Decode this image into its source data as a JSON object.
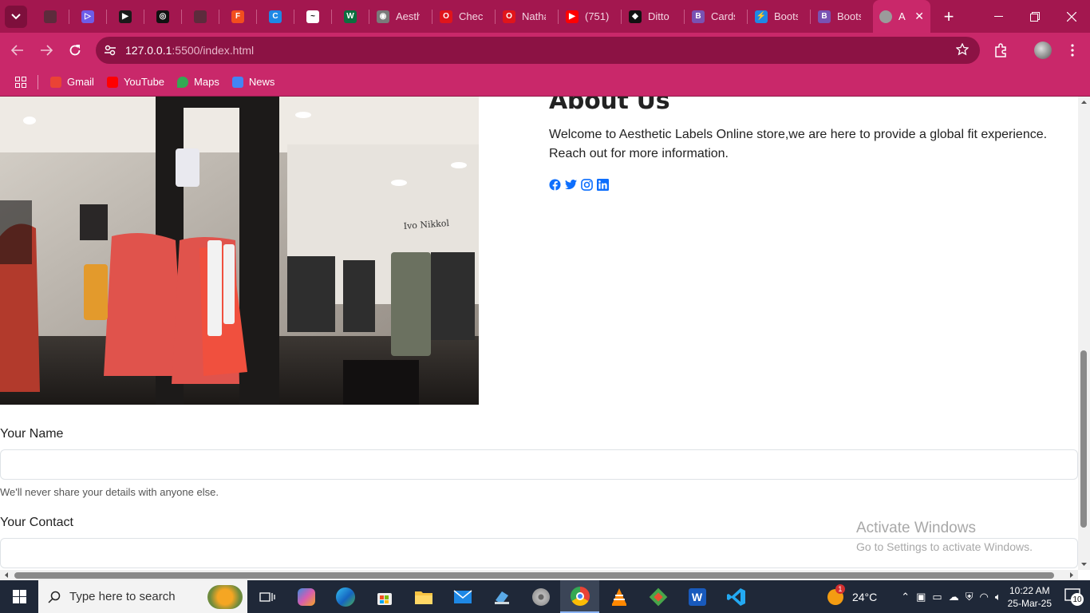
{
  "browser": {
    "tabs": [
      {
        "title": "",
        "fav_color": "#5d2b3c",
        "fav_text": "",
        "pinned": true
      },
      {
        "title": "",
        "fav_color": "#6d5ce8",
        "fav_text": "▷",
        "pinned": true
      },
      {
        "title": "",
        "fav_color": "#1a1a1a",
        "fav_text": "▶",
        "pinned": true
      },
      {
        "title": "",
        "fav_color": "#111111",
        "fav_text": "◎",
        "pinned": true
      },
      {
        "title": "",
        "fav_color": "#5d2b3c",
        "fav_text": "",
        "pinned": true
      },
      {
        "title": "",
        "fav_color": "#f24e1e",
        "fav_text": "F",
        "pinned": true
      },
      {
        "title": "",
        "fav_color": "#1e88e5",
        "fav_text": "C",
        "pinned": true
      },
      {
        "title": "",
        "fav_color": "#ffffff",
        "fav_text": "~",
        "pinned": true
      },
      {
        "title": "",
        "fav_color": "#0d6e3f",
        "fav_text": "W",
        "pinned": true
      },
      {
        "title": "Aesth",
        "fav_color": "#7a7a7a",
        "fav_text": "◉",
        "pinned": false
      },
      {
        "title": "Check",
        "fav_color": "#e0151b",
        "fav_text": "O",
        "pinned": false
      },
      {
        "title": "Natha",
        "fav_color": "#e0151b",
        "fav_text": "O",
        "pinned": false
      },
      {
        "title": "(751)",
        "fav_color": "#ff0000",
        "fav_text": "▶",
        "pinned": false
      },
      {
        "title": "Ditto",
        "fav_color": "#111111",
        "fav_text": "◆",
        "pinned": false
      },
      {
        "title": "Cards",
        "fav_color": "#7952b3",
        "fav_text": "B",
        "pinned": false
      },
      {
        "title": "Boots",
        "fav_color": "#1e88e5",
        "fav_text": "⚡",
        "pinned": false
      },
      {
        "title": "Boots",
        "fav_color": "#7952b3",
        "fav_text": "B",
        "pinned": false
      }
    ],
    "active_tab": {
      "title": "A",
      "fav_color": "#9b9b9b"
    },
    "url_host": "127.0.0.1",
    "url_rest": ":5500/index.html",
    "bookmarks": [
      {
        "label": "Gmail",
        "color": "#ea4335"
      },
      {
        "label": "YouTube",
        "color": "#ff0000"
      },
      {
        "label": "Maps",
        "color": "#34a853"
      },
      {
        "label": "News",
        "color": "#4285f4"
      }
    ]
  },
  "about": {
    "heading": "About Us",
    "text": "Welcome to Aesthetic Labels Online store,we are here to provide a global fit experience. Reach out for more information.",
    "social": [
      "facebook-icon",
      "twitter-icon",
      "instagram-icon",
      "linkedin-icon"
    ]
  },
  "photo": {
    "store_sign": "Ivo Nikkol"
  },
  "form": {
    "name_label": "Your Name",
    "name_value": "",
    "name_help": "We'll never share your details with anyone else.",
    "contact_label": "Your Contact",
    "contact_value": ""
  },
  "watermark": {
    "title": "Activate Windows",
    "subtitle": "Go to Settings to activate Windows."
  },
  "taskbar": {
    "search_placeholder": "Type here to search",
    "weather": "24°C",
    "weather_badge": "1",
    "time": "10:22 AM",
    "date": "25-Mar-25",
    "notification_count": "10"
  }
}
